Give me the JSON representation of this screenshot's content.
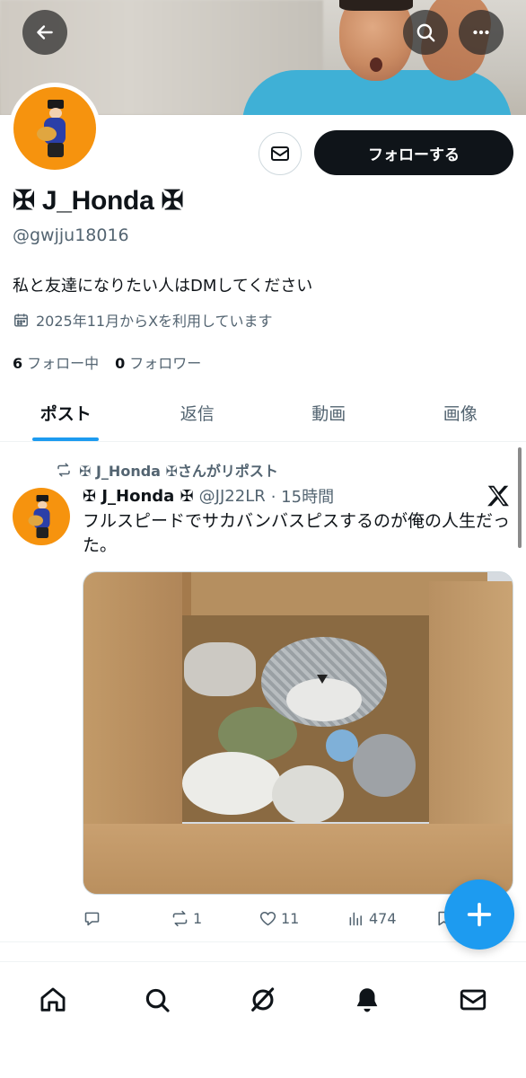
{
  "header": {
    "back_icon": "arrow-left-icon",
    "search_icon": "search-icon",
    "more_icon": "more-horizontal-icon"
  },
  "profile": {
    "display_name": "✠ J_Honda ✠",
    "handle": "@gwjju18016",
    "bio": "私と友達になりたい人はDMしてください",
    "joined": "2025年11月からXを利用しています",
    "following_count": "6",
    "following_label": "フォロー中",
    "followers_count": "0",
    "followers_label": "フォロワー",
    "follow_button": "フォローする",
    "dm_icon": "envelope-icon"
  },
  "tabs": [
    {
      "label": "ポスト",
      "active": true
    },
    {
      "label": "返信",
      "active": false
    },
    {
      "label": "動画",
      "active": false
    },
    {
      "label": "画像",
      "active": false
    }
  ],
  "post": {
    "repost_text": "✠ J_Honda ✠さんがリポスト",
    "author_name": "✠ J_Honda ✠",
    "author_handle": "@JJ22LR",
    "time": "· 15時間",
    "text": "フルスピードでサカバンバスピスするのが俺の人生だった。",
    "replies": "",
    "reposts": "1",
    "likes": "11",
    "views": "474"
  },
  "colors": {
    "accent": "#1d9bf0",
    "text_primary": "#0f1419",
    "text_secondary": "#536471",
    "avatar_bg": "#f6930e"
  },
  "nav": [
    "home-icon",
    "search-icon",
    "grok-icon",
    "notifications-icon",
    "messages-icon"
  ]
}
